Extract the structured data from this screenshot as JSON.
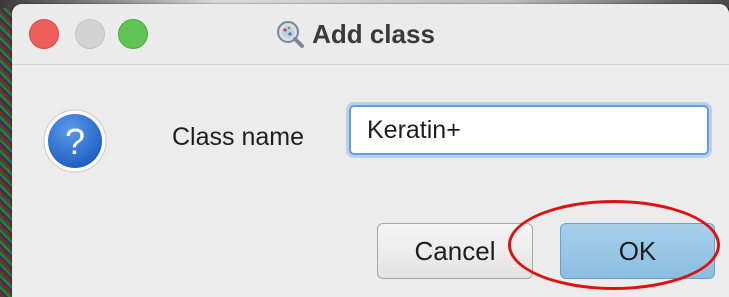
{
  "window": {
    "title": "Add class"
  },
  "form": {
    "label": "Class name",
    "value": "Keratin+"
  },
  "buttons": {
    "cancel_label": "Cancel",
    "ok_label": "OK"
  },
  "icons": {
    "app": "qupath-magnifier-icon",
    "dialog": "question-mark-icon"
  },
  "colors": {
    "ok_button": "#98c6e6",
    "highlight": "#e01010",
    "input_focus": "#5fa0e0"
  }
}
